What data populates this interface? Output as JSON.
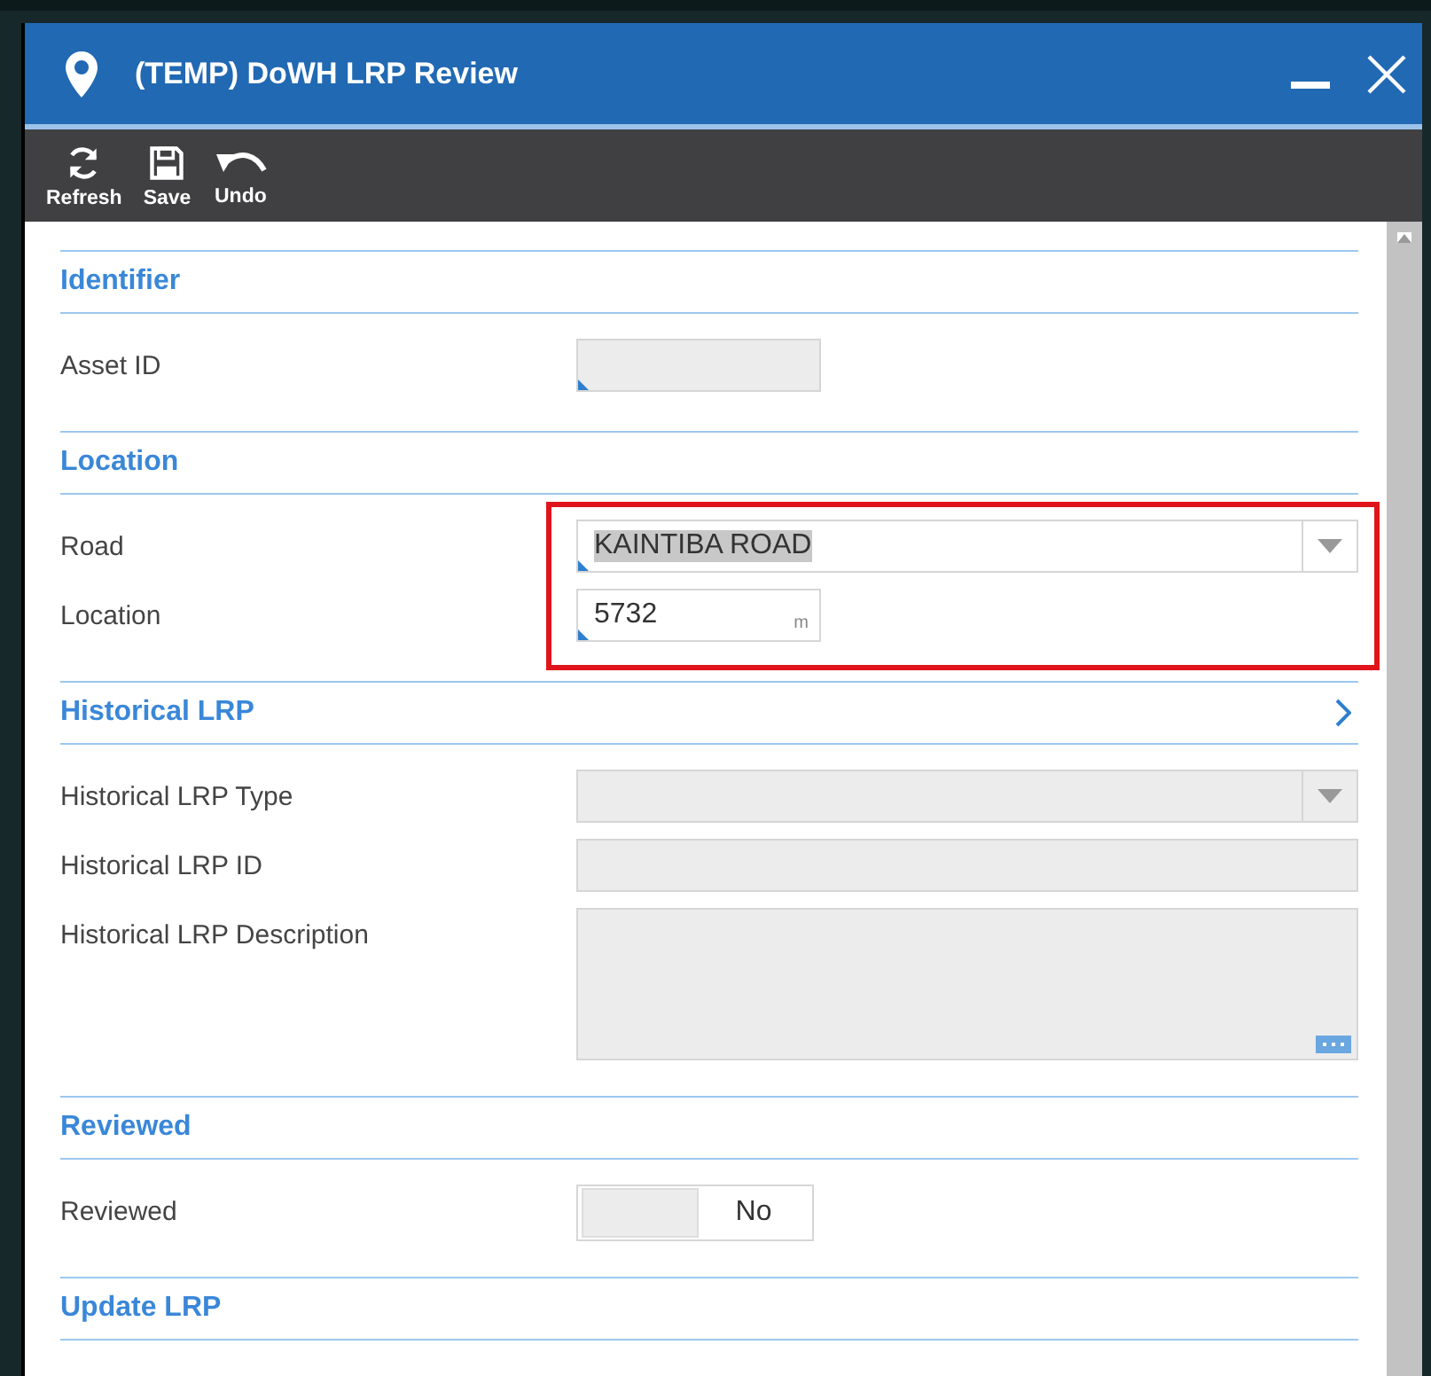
{
  "window": {
    "title": "(TEMP) DoWH LRP Review"
  },
  "toolbar": [
    {
      "label": "Refresh"
    },
    {
      "label": "Save"
    },
    {
      "label": "Undo"
    }
  ],
  "sections": [
    {
      "title": "Identifier",
      "expandable": false,
      "fields": [
        {
          "label": "Asset ID",
          "kind": "short_text",
          "disabled": true,
          "required": true
        }
      ]
    },
    {
      "title": "Location",
      "expandable": false,
      "highlighted": true,
      "fields": [
        {
          "label": "Road",
          "kind": "dropdown",
          "disabled": false,
          "required": true,
          "value": "KAINTIBA ROAD",
          "selected_text": true
        },
        {
          "label": "Location",
          "kind": "number",
          "disabled": false,
          "required": true,
          "value": "5732",
          "unit": "m"
        }
      ]
    },
    {
      "title": "Historical LRP",
      "expandable": true,
      "fields": [
        {
          "label": "Historical LRP Type",
          "kind": "dropdown",
          "disabled": true,
          "required": false
        },
        {
          "label": "Historical LRP ID",
          "kind": "text",
          "disabled": true,
          "required": false
        },
        {
          "label": "Historical LRP Description",
          "kind": "textarea",
          "disabled": true,
          "required": false
        }
      ]
    },
    {
      "title": "Reviewed",
      "expandable": false,
      "fields": [
        {
          "label": "Reviewed",
          "kind": "toggle",
          "on": false,
          "value": "No"
        }
      ]
    },
    {
      "title": "Update LRP",
      "expandable": false
    }
  ]
}
